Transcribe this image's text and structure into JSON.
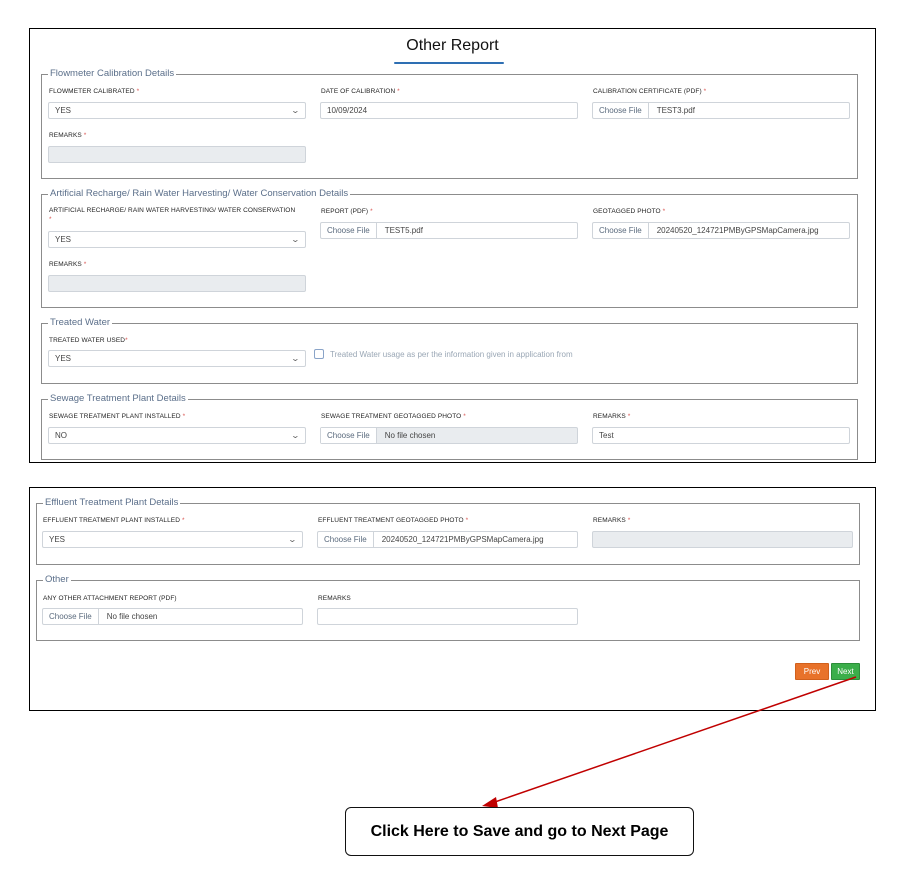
{
  "page_title": "Other Report",
  "flowmeter": {
    "legend": "Flowmeter Calibration Details",
    "calibrated_label": "FLOWMETER CALIBRATED",
    "calibrated_value": "YES",
    "date_label": "DATE OF CALIBRATION",
    "date_value": "10/09/2024",
    "certificate_label": "CALIBRATION CERTIFICATE (PDF)",
    "certificate_btn": "Choose File",
    "certificate_file": "TEST3.pdf",
    "remarks_label": "REMARKS",
    "remarks_value": ""
  },
  "recharge": {
    "legend": "Artificial Recharge/ Rain Water Harvesting/ Water Conservation Details",
    "field_label": "ARTIFICIAL RECHARGE/ RAIN WATER HARVESTING/ WATER CONSERVATION",
    "field_value": "YES",
    "report_label": "REPORT (PDF)",
    "report_btn": "Choose File",
    "report_file": "TEST5.pdf",
    "photo_label": "GEOTAGGED PHOTO",
    "photo_btn": "Choose File",
    "photo_file": "20240520_124721PMByGPSMapCamera.jpg",
    "remarks_label": "REMARKS",
    "remarks_value": ""
  },
  "treated": {
    "legend": "Treated Water",
    "used_label": "TREATED WATER USED",
    "used_value": "YES",
    "checkbox_label": "Treated Water usage as per the information given in application from"
  },
  "sewage": {
    "legend": "Sewage Treatment Plant Details",
    "installed_label": "SEWAGE TREATMENT PLANT INSTALLED",
    "installed_value": "NO",
    "photo_label": "SEWAGE TREATMENT GEOTAGGED PHOTO",
    "photo_btn": "Choose File",
    "photo_file": "No file chosen",
    "remarks_label": "REMARKS",
    "remarks_value": "Test"
  },
  "effluent": {
    "legend": "Effluent Treatment Plant Details",
    "installed_label": "EFFLUENT TREATMENT PLANT INSTALLED",
    "installed_value": "YES",
    "photo_label": "EFFLUENT TREATMENT GEOTAGGED PHOTO",
    "photo_btn": "Choose File",
    "photo_file": "20240520_124721PMByGPSMapCamera.jpg",
    "remarks_label": "REMARKS",
    "remarks_value": ""
  },
  "other": {
    "legend": "Other",
    "attachment_label": "ANY OTHER ATTACHMENT REPORT (PDF)",
    "attachment_btn": "Choose File",
    "attachment_file": "No file chosen",
    "remarks_label": "REMARKS",
    "remarks_value": ""
  },
  "nav": {
    "prev_label": "Prev",
    "next_label": "Next"
  },
  "callout": {
    "text": "Click Here to Save and go to Next Page"
  },
  "colors": {
    "prev": "#e8722a",
    "next": "#3bae4a",
    "arrow": "#c00000",
    "required": "#d9534f"
  },
  "icons": {
    "select_arrow": "chevron-down-icon",
    "pointer": "arrow-pointer-icon"
  }
}
